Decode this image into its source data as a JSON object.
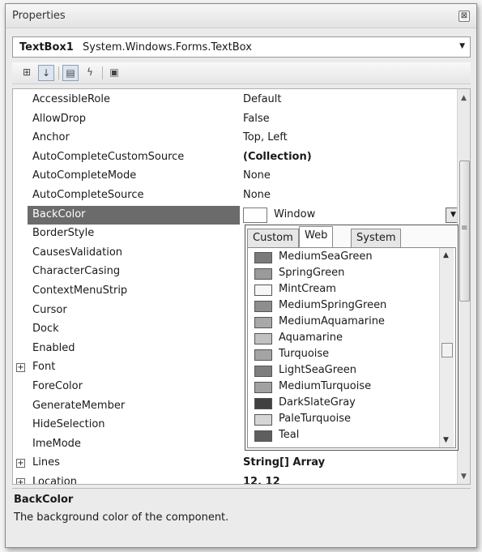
{
  "window": {
    "title": "Properties",
    "close_glyph": "⊠"
  },
  "object_selector": {
    "name": "TextBox1",
    "type": "System.Windows.Forms.TextBox"
  },
  "toolbar": {
    "buttons": [
      {
        "icon": "categorized-icon",
        "glyph": "⊞"
      },
      {
        "icon": "alphabetical-sort-icon",
        "glyph": "↓"
      },
      {
        "icon": "properties-icon",
        "glyph": "▤"
      },
      {
        "icon": "events-lightning-icon",
        "glyph": "ϟ"
      },
      {
        "icon": "property-pages-icon",
        "glyph": "▣"
      }
    ]
  },
  "properties": [
    {
      "name": "AccessibleRole",
      "value": "Default"
    },
    {
      "name": "AllowDrop",
      "value": "False"
    },
    {
      "name": "Anchor",
      "value": "Top, Left"
    },
    {
      "name": "AutoCompleteCustomSource",
      "value": "(Collection)"
    },
    {
      "name": "AutoCompleteMode",
      "value": "None"
    },
    {
      "name": "AutoCompleteSource",
      "value": "None"
    },
    {
      "name": "BackColor",
      "value": "Window"
    },
    {
      "name": "BorderStyle",
      "value": ""
    },
    {
      "name": "CausesValidation",
      "value": ""
    },
    {
      "name": "CharacterCasing",
      "value": ""
    },
    {
      "name": "ContextMenuStrip",
      "value": ""
    },
    {
      "name": "Cursor",
      "value": ""
    },
    {
      "name": "Dock",
      "value": ""
    },
    {
      "name": "Enabled",
      "value": ""
    },
    {
      "name": "Font",
      "value": ""
    },
    {
      "name": "ForeColor",
      "value": ""
    },
    {
      "name": "GenerateMember",
      "value": ""
    },
    {
      "name": "HideSelection",
      "value": ""
    },
    {
      "name": "ImeMode",
      "value": ""
    },
    {
      "name": "Lines",
      "value": "String[] Array"
    },
    {
      "name": "Location",
      "value": "12, 12"
    }
  ],
  "color_picker": {
    "tabs": [
      "Custom",
      "Web",
      "System"
    ],
    "active_tab": "Web",
    "colors": [
      {
        "name": "MediumSeaGreen",
        "color": "#7a7a7a"
      },
      {
        "name": "SpringGreen",
        "color": "#9a9a9a"
      },
      {
        "name": "MintCream",
        "color": "#f7f7f7"
      },
      {
        "name": "MediumSpringGreen",
        "color": "#8e8e8e"
      },
      {
        "name": "MediumAquamarine",
        "color": "#a8a8a8"
      },
      {
        "name": "Aquamarine",
        "color": "#c2c2c2"
      },
      {
        "name": "Turquoise",
        "color": "#a4a4a4"
      },
      {
        "name": "LightSeaGreen",
        "color": "#7e7e7e"
      },
      {
        "name": "MediumTurquoise",
        "color": "#a1a1a1"
      },
      {
        "name": "DarkSlateGray",
        "color": "#404040"
      },
      {
        "name": "PaleTurquoise",
        "color": "#d6d6d6"
      },
      {
        "name": "Teal",
        "color": "#5e5e5e"
      }
    ]
  },
  "description": {
    "title": "BackColor",
    "text": "The background color of the component."
  }
}
